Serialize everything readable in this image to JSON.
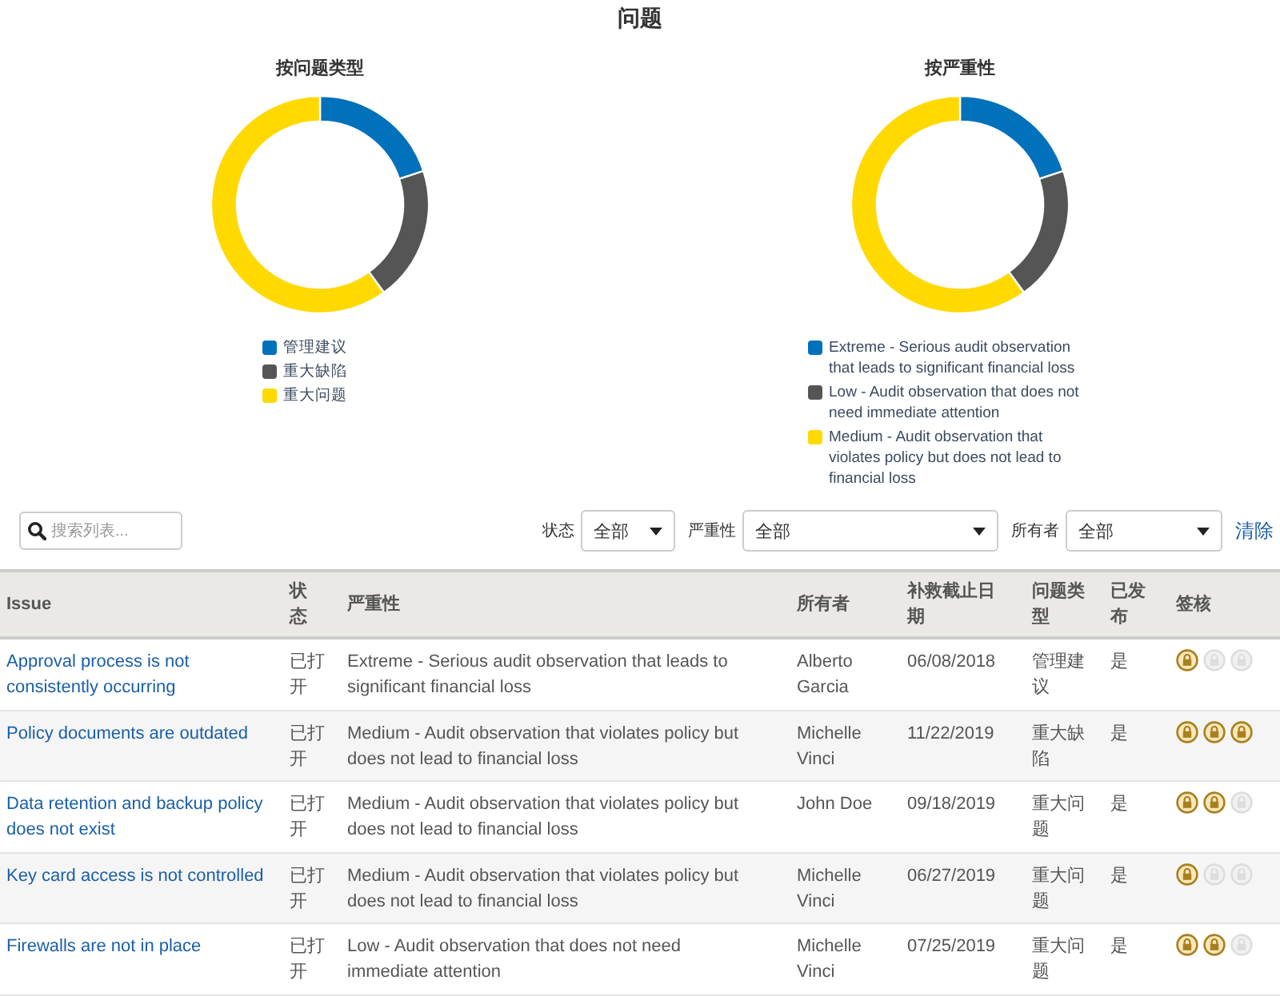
{
  "title": "问题",
  "charts": [
    {
      "title": "按问题类型",
      "chart_data": {
        "type": "donut",
        "legend": "bottom",
        "categories": [
          "管理建议",
          "重大缺陷",
          "重大问题"
        ],
        "colors": [
          "#0071ba",
          "#555555",
          "#ffd900"
        ],
        "values": [
          20,
          20,
          60
        ]
      }
    },
    {
      "title": "按严重性",
      "chart_data": {
        "type": "donut",
        "categories": [
          "Extreme - Serious audit observation that leads to significant financial loss",
          "Low - Audit observation that does not need immediate attention",
          "Medium - Audit observation that violates policy but does not lead to financial loss"
        ],
        "colors": [
          "#0071ba",
          "#555555",
          "#ffd900"
        ],
        "values": [
          20,
          20,
          60
        ],
        "legend": "bottom"
      }
    }
  ],
  "search": {
    "placeholder": "搜索列表..."
  },
  "filters": [
    {
      "label": "状态",
      "value": "全部"
    },
    {
      "label": "严重性",
      "value": "全部"
    },
    {
      "label": "所有者",
      "value": "全部"
    }
  ],
  "clear_link": "清除",
  "table": {
    "columns": [
      "Issue",
      "状态",
      "严重性",
      "所有者",
      "补救截止日期",
      "问题类型",
      "已发布",
      "签核"
    ],
    "rows": [
      {
        "issue": "Approval process is not consistently occurring",
        "status": "已打开",
        "severity": "Extreme - Serious audit observation that leads to significant financial loss",
        "owner": "Alberto Garcia",
        "due": "06/08/2018",
        "type": "管理建议",
        "published": "是",
        "signoffs": [
          {
            "signed": true
          },
          {
            "signed": false
          },
          {
            "signed": false
          }
        ]
      },
      {
        "issue": "Policy documents are outdated",
        "status": "已打开",
        "severity": "Medium - Audit observation that violates policy but does not lead to financial loss",
        "owner": "Michelle Vinci",
        "due": "11/22/2019",
        "type": "重大缺陷",
        "published": "是",
        "signoffs": [
          {
            "signed": true
          },
          {
            "signed": true
          },
          {
            "signed": true
          }
        ]
      },
      {
        "issue": "Data retention and backup policy does not exist",
        "status": "已打开",
        "severity": "Medium - Audit observation that violates policy but does not lead to financial loss",
        "owner": "John Doe",
        "due": "09/18/2019",
        "type": "重大问题",
        "published": "是",
        "signoffs": [
          {
            "signed": true
          },
          {
            "signed": true
          },
          {
            "signed": false
          }
        ]
      },
      {
        "issue": "Key card access is not controlled",
        "status": "已打开",
        "severity": "Medium - Audit observation that violates policy but does not lead to financial loss",
        "owner": "Michelle Vinci",
        "due": "06/27/2019",
        "type": "重大问题",
        "published": "是",
        "signoffs": [
          {
            "signed": true
          },
          {
            "signed": false
          },
          {
            "signed": false
          }
        ]
      },
      {
        "issue": "Firewalls are not in place",
        "status": "已打开",
        "severity": "Low - Audit observation that does not need immediate attention",
        "owner": "Michelle Vinci",
        "due": "07/25/2019",
        "type": "重大问题",
        "published": "是",
        "signoffs": [
          {
            "signed": true
          },
          {
            "signed": true
          },
          {
            "signed": false
          }
        ]
      }
    ]
  }
}
